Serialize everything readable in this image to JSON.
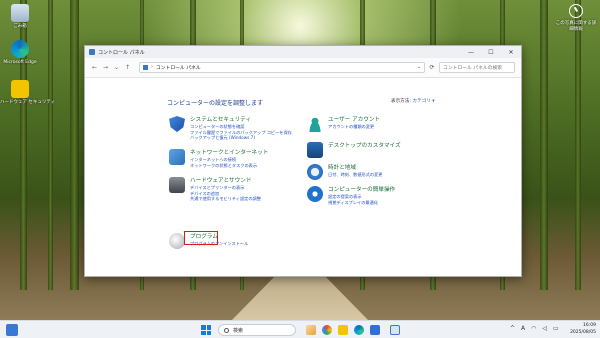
{
  "desktop": {
    "icons": [
      {
        "label": "ごみ箱"
      },
      {
        "label": "Microsoft Edge"
      },
      {
        "label": "ハードウェア セキュリティ"
      }
    ],
    "widget": {
      "line1": "この写真に関する詳",
      "line2": "細情報"
    }
  },
  "window": {
    "title": "コントロール パネル",
    "controls": {
      "minimize": "—",
      "maximize": "☐",
      "close": "✕"
    },
    "nav": {
      "back": "←",
      "forward": "→",
      "recent": "⌄",
      "up": "↑"
    },
    "address": {
      "separator": "›",
      "location": "コントロール パネル",
      "dropdown": "⌄"
    },
    "refresh": "⟳",
    "search_placeholder": "コントロール パネルの検索",
    "heading": "コンピューターの設定を調整します",
    "view_by": {
      "label": "表示方法:",
      "value": "カテゴリ ▾"
    },
    "categories_left": [
      {
        "title": "システムとセキュリティ",
        "links": [
          "コンピューターの状態を確認",
          "ファイル履歴でファイルのバックアップ コピーを保存",
          "バックアップと復元 (Windows 7)"
        ]
      },
      {
        "title": "ネットワークとインターネット",
        "links": [
          "インターネットへの接続",
          "ネットワークの状態とタスクの表示"
        ]
      },
      {
        "title": "ハードウェアとサウンド",
        "links": [
          "デバイスとプリンターの表示",
          "デバイスの追加",
          "共通で使用するモビリティ設定の調整"
        ]
      },
      {
        "title": "プログラム",
        "links": [
          "プログラムのアンインストール"
        ]
      }
    ],
    "categories_right": [
      {
        "title": "ユーザー アカウント",
        "links": [
          "アカウントの種類の変更"
        ]
      },
      {
        "title": "デスクトップのカスタマイズ",
        "links": []
      },
      {
        "title": "時計と地域",
        "links": [
          "日付、時刻、数値形式の変更"
        ]
      },
      {
        "title": "コンピューターの簡単操作",
        "links": [
          "設定の提案の表示",
          "視覚ディスプレイの最適化"
        ]
      }
    ]
  },
  "taskbar": {
    "search_label": "検索",
    "tray": {
      "chevron": "^",
      "ime": "A"
    },
    "time": "16:09",
    "date": "2025/08/05"
  }
}
